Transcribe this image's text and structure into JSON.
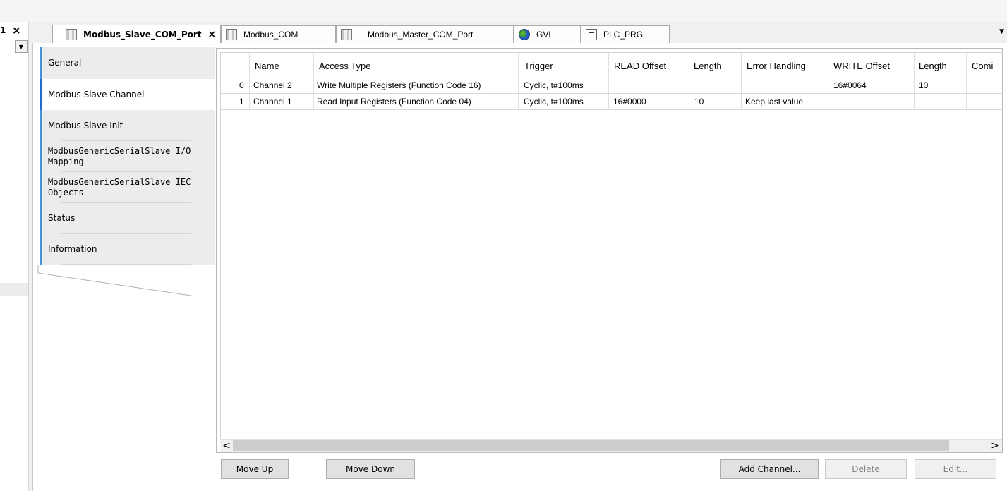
{
  "left_panel": {
    "partial_number": "1",
    "close_glyph": "×"
  },
  "tabs": [
    {
      "label": "Modbus_Slave_COM_Port",
      "icon": "device-icon",
      "active": true,
      "close": "×"
    },
    {
      "label": "Modbus_COM",
      "icon": "device-icon"
    },
    {
      "label": "Modbus_Master_COM_Port",
      "icon": "device-icon"
    },
    {
      "label": "GVL",
      "icon": "globe-icon"
    },
    {
      "label": "PLC_PRG",
      "icon": "document-icon"
    }
  ],
  "nav": [
    {
      "label": "General"
    },
    {
      "label": "Modbus Slave Channel",
      "active": true
    },
    {
      "label": "Modbus Slave Init"
    },
    {
      "label": "ModbusGenericSerialSlave I/O Mapping"
    },
    {
      "label": "ModbusGenericSerialSlave IEC Objects"
    },
    {
      "label": "Status"
    },
    {
      "label": "Information"
    }
  ],
  "table": {
    "columns": [
      "Name",
      "Access Type",
      "Trigger",
      "READ Offset",
      "Length",
      "Error Handling",
      "WRITE Offset",
      "Length",
      "Comi"
    ],
    "rows": [
      {
        "index": "0",
        "name": "Channel 2",
        "access": "Write Multiple Registers (Function Code 16)",
        "trigger": "Cyclic, t#100ms",
        "read_offset": "",
        "read_length": "",
        "error": "",
        "write_offset": "16#0064",
        "write_length": "10"
      },
      {
        "index": "1",
        "name": "Channel 1",
        "access": "Read Input Registers (Function Code 04)",
        "trigger": "Cyclic, t#100ms",
        "read_offset": "16#0000",
        "read_length": "10",
        "error": "Keep last value",
        "write_offset": "",
        "write_length": ""
      }
    ]
  },
  "scroll": {
    "left": "<",
    "right": ">"
  },
  "buttons": {
    "move_up": "Move Up",
    "move_down": "Move Down",
    "add_channel": "Add Channel...",
    "delete": "Delete",
    "edit": "Edit..."
  },
  "colors": {
    "accent": "#1f6fd0",
    "nav_stripe": "#4a90d9",
    "nav_bg": "#ececec",
    "disabled_text": "#838383"
  }
}
